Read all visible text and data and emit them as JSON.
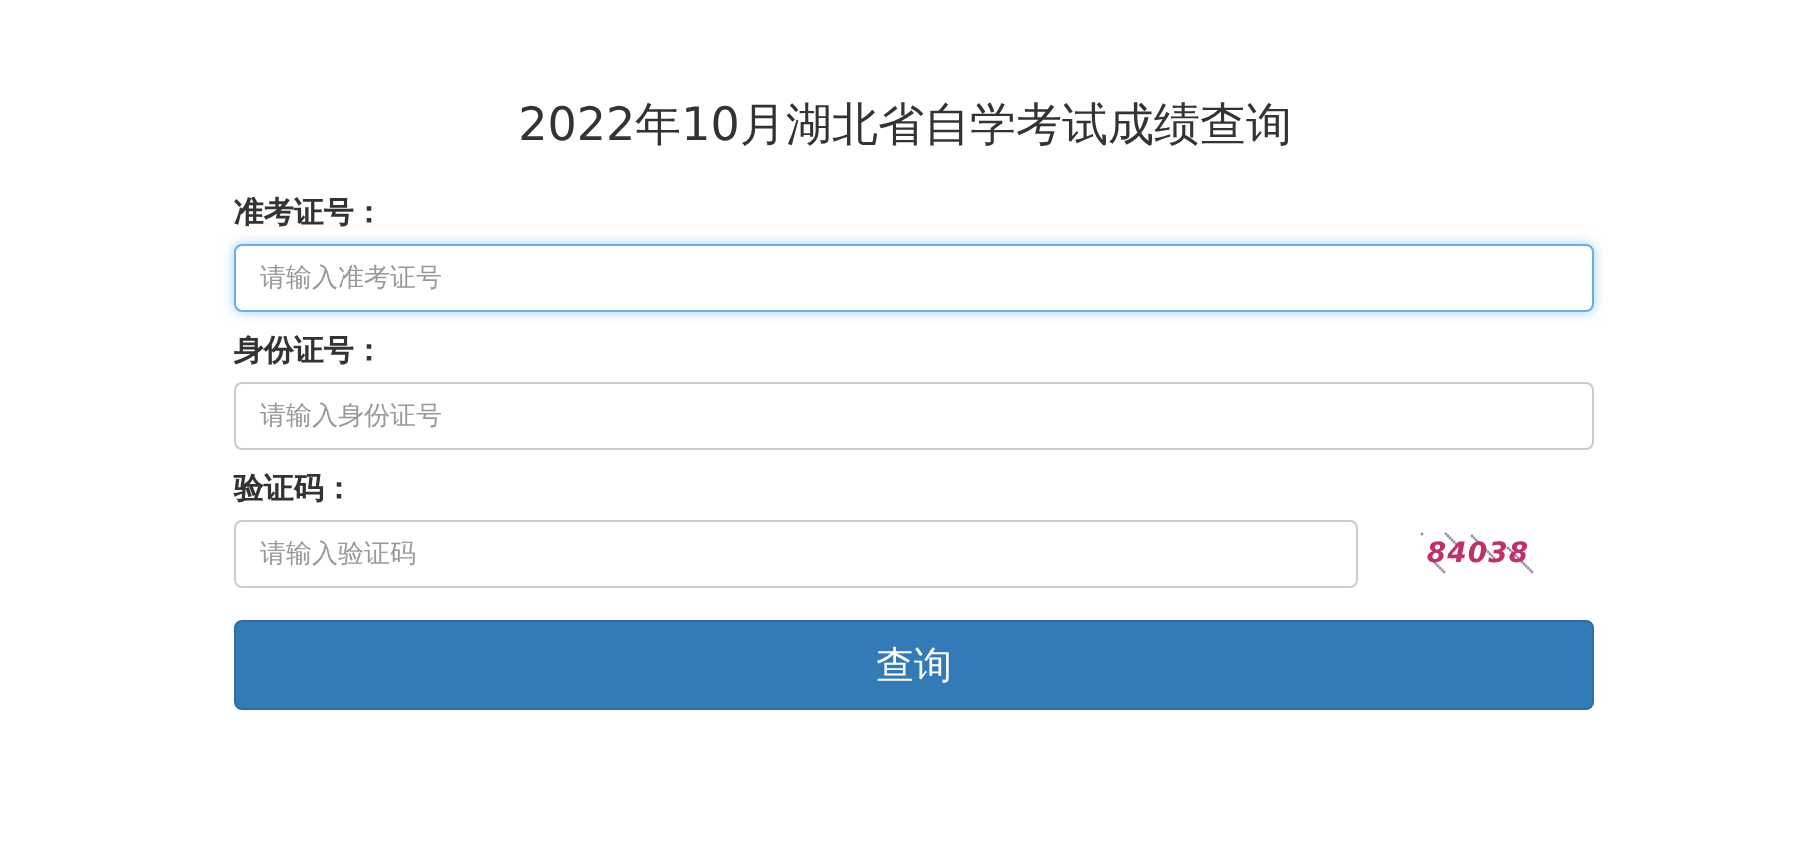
{
  "title": "2022年10月湖北省自学考试成绩查询",
  "fields": [
    {
      "label": "准考证号：",
      "placeholder": "请输入准考证号",
      "focused": true,
      "kind": "text"
    },
    {
      "label": "身份证号：",
      "placeholder": "请输入身份证号",
      "focused": false,
      "kind": "text"
    },
    {
      "label": "验证码：",
      "placeholder": "请输入验证码",
      "focused": false,
      "kind": "captcha",
      "captcha": "84038"
    }
  ],
  "button": "查询"
}
